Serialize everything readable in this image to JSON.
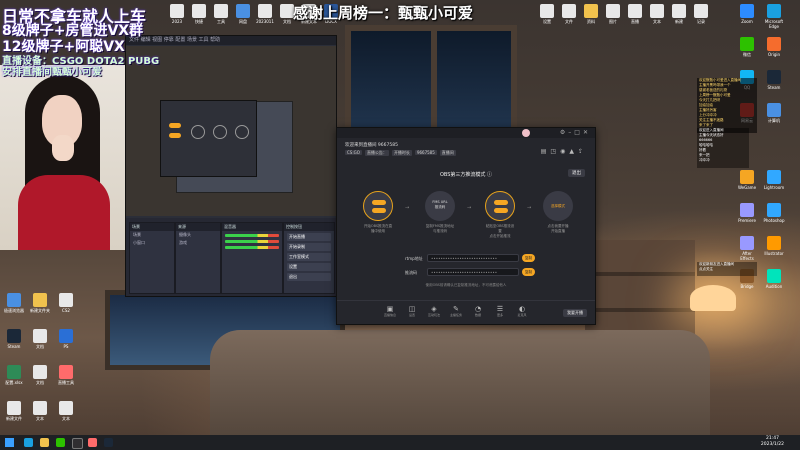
{
  "overlay": {
    "top_caption": "感谢上周榜一：甄甄小可爱",
    "line1": "日常不拿车就人上车",
    "line2": "8级牌子+房管进VX群",
    "line3": "12级牌子+阿聪VX",
    "line4": "直播设备：CSGO DOTA2 PUBG",
    "line5": "安排直播间甄甄小可爱"
  },
  "obs": {
    "menu": "文件 编辑 视图 停靠 配置 场景 工具 帮助",
    "scenes_title": "场景",
    "sources_title": "来源",
    "mixer_title": "混音器",
    "controls_title": "控制按钮",
    "controls": [
      "开始直播",
      "开始录制",
      "工作室模式",
      "设置",
      "退出"
    ],
    "scene_rows": [
      "场景",
      "小窗口"
    ],
    "source_rows": [
      "摄像头",
      "游戏"
    ]
  },
  "app": {
    "header_title": "欢迎来到直播间 9667585",
    "badges": [
      "CS:GO",
      "直播公告：",
      "开播时长",
      "9667585",
      "直播间"
    ],
    "mode_title": "OBS第三方推流模式 ⓘ",
    "exit_label": "退出",
    "steps": [
      {
        "label": "",
        "caption": "开始OBS推流在直播中使用"
      },
      {
        "label": "FMS URL\n推流码",
        "caption": "复制FMS推流地址与推流码"
      },
      {
        "label": "",
        "caption": "粘贴至OBS推流设置\n点击开始推流"
      },
      {
        "label": "选择模式",
        "caption": "点击我要开播\n开始直播"
      }
    ],
    "rtmp_label": "rtmp地址",
    "rtmp_value": "••••••••••••••••••••••••••••",
    "key_label": "推流码",
    "key_value": "••••••••••••••••••••••••••••",
    "copy_label": "复制",
    "hint": "使用OBS前请确认已复制推流地址，不可泄露给他人",
    "tools": [
      {
        "glyph": "▣",
        "label": "直播信息"
      },
      {
        "glyph": "◫",
        "label": "设置"
      },
      {
        "glyph": "◈",
        "label": "互动玩法"
      },
      {
        "glyph": "✎",
        "label": "主播任务"
      },
      {
        "glyph": "◔",
        "label": "数据"
      },
      {
        "glyph": "☰",
        "label": "更多"
      },
      {
        "glyph": "◐",
        "label": "麦克风"
      }
    ],
    "live_button": "我要开播"
  },
  "chat": {
    "lines1": [
      "欢迎甄甄小可爱进入直播间",
      "主播开黑吗带我一个",
      "感谢老板送的礼物",
      "上周榜一甄甄小可爱",
      "今天打几把呀",
      "加油加油",
      "主播好厉害",
      "上分冲冲冲",
      "关注主播不迷路",
      "来了来了"
    ],
    "lines2": [
      "欢迎进入直播间",
      "主播今天状态好",
      "666666",
      "哈哈哈哈",
      "好看",
      "来一把",
      "冲冲冲"
    ],
    "lines3": [
      "欢迎新朋友进入直播间",
      "点点关注"
    ]
  },
  "desktop_left": [
    {
      "label": "极速浏览器",
      "color": "#4a90e2"
    },
    {
      "label": "新建文件夹",
      "color": "#f1c24d"
    },
    {
      "label": "CS2",
      "color": "#e8e8e8"
    },
    {
      "label": "Steam",
      "color": "#1b2838"
    },
    {
      "label": "文档",
      "color": "#e8e8e8"
    },
    {
      "label": "PS",
      "color": "#2a6fd6"
    },
    {
      "label": "配置.xlsx",
      "color": "#2e8b57"
    },
    {
      "label": "文档",
      "color": "#e8e8e8"
    },
    {
      "label": "直播工具",
      "color": "#ff6b6b"
    },
    {
      "label": "新建文件",
      "color": "#e8e8e8"
    },
    {
      "label": "文本",
      "color": "#e8e8e8"
    },
    {
      "label": "文本",
      "color": "#e8e8e8"
    }
  ],
  "desktop_top": [
    {
      "label": "2023",
      "color": "#e8e8e8"
    },
    {
      "label": "快捷",
      "color": "#e8e8e8"
    },
    {
      "label": "工具",
      "color": "#e8e8e8"
    },
    {
      "label": "网盘",
      "color": "#4a90e2"
    },
    {
      "label": "2023011",
      "color": "#e8e8e8"
    },
    {
      "label": "文档",
      "color": "#e8e8e8"
    },
    {
      "label": "新建文本",
      "color": "#e8e8e8"
    },
    {
      "label": "DOCX",
      "color": "#2b579a"
    },
    {
      "label": "设置",
      "color": "#e8e8e8"
    },
    {
      "label": "文件",
      "color": "#e8e8e8"
    },
    {
      "label": "资料",
      "color": "#f1c24d"
    },
    {
      "label": "图片",
      "color": "#e8e8e8"
    },
    {
      "label": "直播",
      "color": "#e8e8e8"
    },
    {
      "label": "文本",
      "color": "#e8e8e8"
    },
    {
      "label": "新建",
      "color": "#e8e8e8"
    },
    {
      "label": "记录",
      "color": "#e8e8e8"
    }
  ],
  "desktop_right": [
    {
      "label": "Zoom",
      "color": "#2d8cff"
    },
    {
      "label": "Microsoft Edge",
      "color": "#1aa0e0"
    },
    {
      "label": "微信",
      "color": "#2dc100"
    },
    {
      "label": "Origin",
      "color": "#f56c2d"
    },
    {
      "label": "QQ",
      "color": "#12b7f5"
    },
    {
      "label": "Steam",
      "color": "#1b2838"
    },
    {
      "label": "网易云",
      "color": "#d43c33"
    },
    {
      "label": "计算机",
      "color": "#4a90e2"
    },
    {
      "label": "WeGame",
      "color": "#f5a623"
    },
    {
      "label": "Lightroom",
      "color": "#31a8ff"
    },
    {
      "label": "Premiere",
      "color": "#9999ff"
    },
    {
      "label": "Photoshop",
      "color": "#31a8ff"
    },
    {
      "label": "After Effects",
      "color": "#9999ff"
    },
    {
      "label": "Illustrator",
      "color": "#ff9a00"
    },
    {
      "label": "Bridge",
      "color": "#8b5a2b"
    },
    {
      "label": "Audition",
      "color": "#00e4bb"
    }
  ],
  "taskbar": {
    "time": "21:47",
    "date": "2023/1/22"
  }
}
